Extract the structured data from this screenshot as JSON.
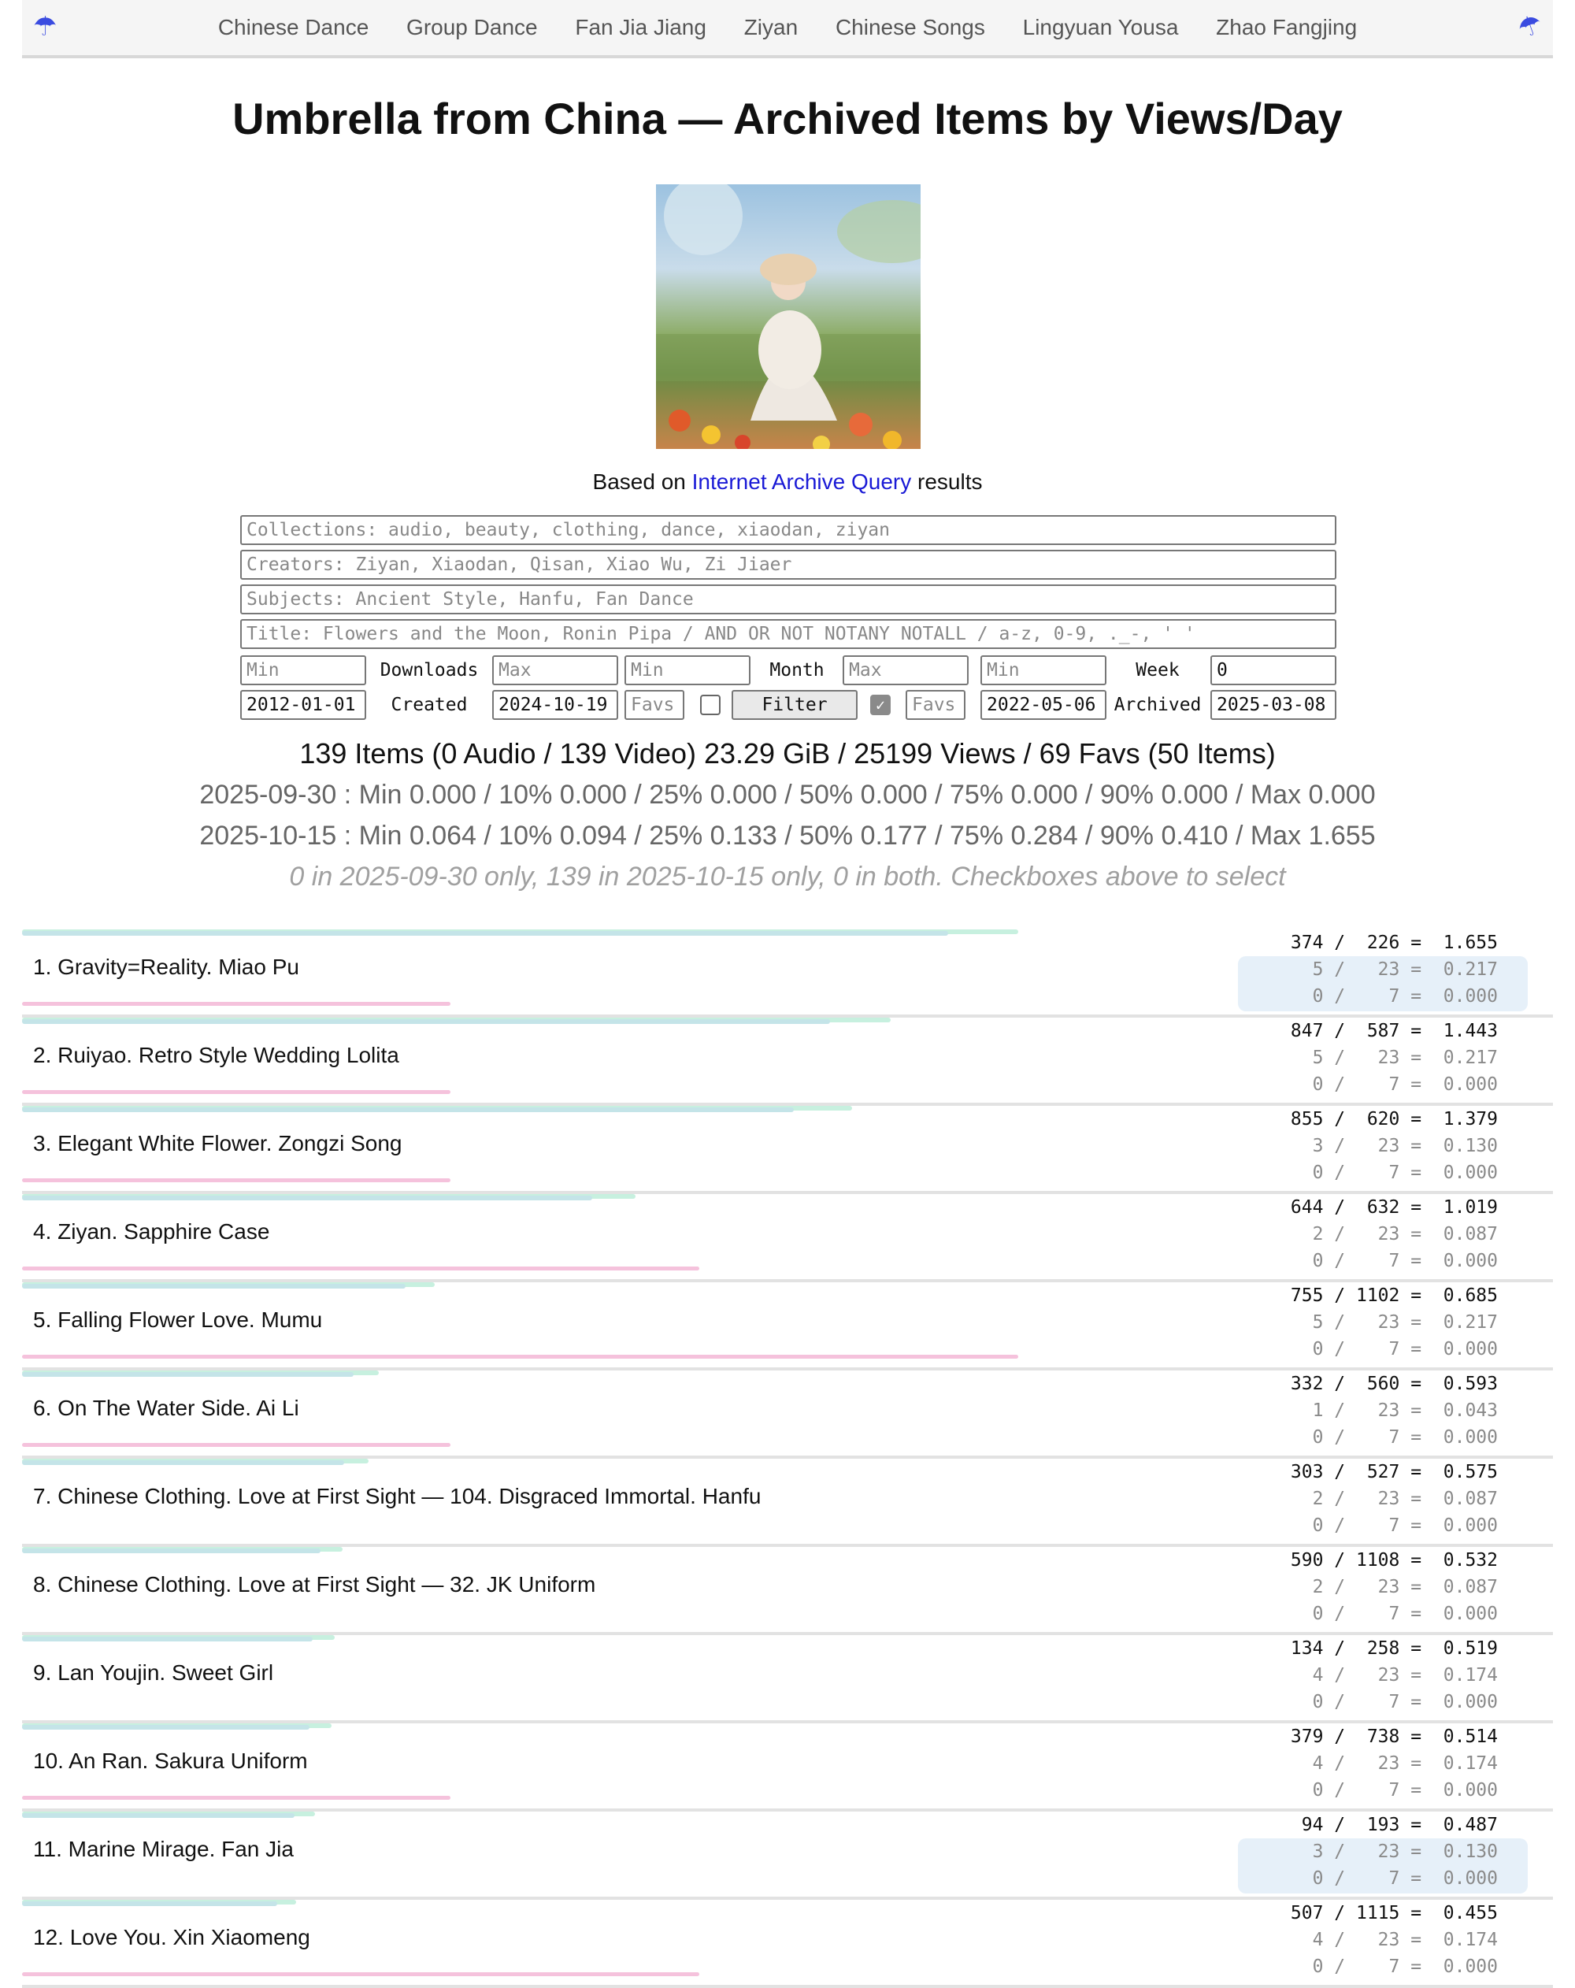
{
  "nav": {
    "links": [
      "Chinese Dance",
      "Group Dance",
      "Fan Jia Jiang",
      "Ziyan",
      "Chinese Songs",
      "Lingyuan Yousa",
      "Zhao Fangjing"
    ],
    "left_icon": "umbrella-icon",
    "right_icon": "closed-umbrella-icon"
  },
  "page_title": "Umbrella from China — Archived Items by Views/Day",
  "based": {
    "prefix": "Based on ",
    "link": "Internet Archive Query",
    "suffix": " results"
  },
  "filters": {
    "collections_placeholder": "Collections: audio, beauty, clothing, dance, xiaodan, ziyan",
    "creators_placeholder": "Creators: Ziyan, Xiaodan, Qisan, Xiao Wu, Zi Jiaer",
    "subjects_placeholder": "Subjects: Ancient Style, Hanfu, Fan Dance",
    "title_placeholder": "Title: Flowers and the Moon, Ronin Pipa / AND OR NOT NOTANY NOTALL / a-z, 0-9, ._-, ' '",
    "min_placeholder": "Min",
    "max_placeholder": "Max",
    "downloads_label": "Downloads",
    "month_label": "Month",
    "week_label": "Week",
    "week_value": "0",
    "created_label": "Created",
    "created_from": "2012-01-01",
    "created_to": "2024-10-19",
    "favs_placeholder": "Favs",
    "filter_button": "Filter",
    "archived_label": "Archived",
    "archived_from": "2022-05-06",
    "archived_to": "2025-03-08",
    "favs_checkbox_left": false,
    "favs_checkbox_right": true
  },
  "summary": "139 Items (0 Audio / 139 Video) 23.29 GiB / 25199 Views / 69 Favs (50 Items)",
  "stats": [
    "2025-09-30 : Min 0.000 / 10% 0.000 / 25% 0.000 / 50% 0.000 / 75% 0.000 / 90% 0.000 / Max 0.000",
    "2025-10-15 : Min 0.064 / 10% 0.094 / 25% 0.133 / 50% 0.177 / 75% 0.284 / 90% 0.410 / Max 1.655"
  ],
  "note": "0 in 2025-09-30 only, 139 in 2025-10-15 only, 0 in both. Checkboxes above to select",
  "colors": {
    "link": "#1a1ad6",
    "views_bar": "#c7f0df",
    "views_bar2": "#c4e4e8",
    "favs_bar": "#f5c2dc",
    "highlight": "#e6f0f9"
  },
  "items": [
    {
      "title": "1. Gravity=Reality. Miao Pu",
      "lines": [
        "374 /  226 =  1.655",
        "5 /   23 =  0.217",
        "0 /    7 =  0.000"
      ],
      "views_per_day": 1.655,
      "favs_fraction": 0.43,
      "highlight": true
    },
    {
      "title": "2. Ruiyao. Retro Style Wedding Lolita",
      "lines": [
        "847 /  587 =  1.443",
        "5 /   23 =  0.217",
        "0 /    7 =  0.000"
      ],
      "views_per_day": 1.443,
      "favs_fraction": 0.43,
      "highlight": false
    },
    {
      "title": "3. Elegant White Flower. Zongzi Song",
      "lines": [
        "855 /  620 =  1.379",
        "3 /   23 =  0.130",
        "0 /    7 =  0.000"
      ],
      "views_per_day": 1.379,
      "favs_fraction": 0.43,
      "highlight": false
    },
    {
      "title": "4. Ziyan. Sapphire Case",
      "lines": [
        "644 /  632 =  1.019",
        "2 /   23 =  0.087",
        "0 /    7 =  0.000"
      ],
      "views_per_day": 1.019,
      "favs_fraction": 0.68,
      "highlight": false
    },
    {
      "title": "5. Falling Flower Love. Mumu",
      "lines": [
        "755 / 1102 =  0.685",
        "5 /   23 =  0.217",
        "0 /    7 =  0.000"
      ],
      "views_per_day": 0.685,
      "favs_fraction": 1.0,
      "highlight": false
    },
    {
      "title": "6. On The Water Side. Ai Li",
      "lines": [
        "332 /  560 =  0.593",
        "1 /   23 =  0.043",
        "0 /    7 =  0.000"
      ],
      "views_per_day": 0.593,
      "favs_fraction": 0.43,
      "highlight": false
    },
    {
      "title": "7. Chinese Clothing. Love at First Sight — 104. Disgraced Immortal. Hanfu",
      "lines": [
        "303 /  527 =  0.575",
        "2 /   23 =  0.087",
        "0 /    7 =  0.000"
      ],
      "views_per_day": 0.575,
      "favs_fraction": 0,
      "highlight": false
    },
    {
      "title": "8. Chinese Clothing. Love at First Sight — 32. JK Uniform",
      "lines": [
        "590 / 1108 =  0.532",
        "2 /   23 =  0.087",
        "0 /    7 =  0.000"
      ],
      "views_per_day": 0.532,
      "favs_fraction": 0,
      "highlight": false
    },
    {
      "title": "9. Lan Youjin. Sweet Girl",
      "lines": [
        "134 /  258 =  0.519",
        "4 /   23 =  0.174",
        "0 /    7 =  0.000"
      ],
      "views_per_day": 0.519,
      "favs_fraction": 0,
      "highlight": false
    },
    {
      "title": "10. An Ran. Sakura Uniform",
      "lines": [
        "379 /  738 =  0.514",
        "4 /   23 =  0.174",
        "0 /    7 =  0.000"
      ],
      "views_per_day": 0.514,
      "favs_fraction": 0.43,
      "highlight": false
    },
    {
      "title": "11. Marine Mirage. Fan Jia",
      "lines": [
        "94 /  193 =  0.487",
        "3 /   23 =  0.130",
        "0 /    7 =  0.000"
      ],
      "views_per_day": 0.487,
      "favs_fraction": 0,
      "highlight": true
    },
    {
      "title": "12. Love You. Xin Xiaomeng",
      "lines": [
        "507 / 1115 =  0.455",
        "4 /   23 =  0.174",
        "0 /    7 =  0.000"
      ],
      "views_per_day": 0.455,
      "favs_fraction": 0.68,
      "highlight": false
    }
  ]
}
